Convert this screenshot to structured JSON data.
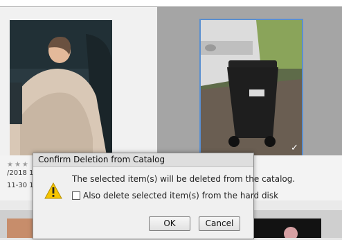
{
  "grid": {
    "left_item": {
      "rating_stars": "★★★",
      "date_text": "/2018 1:4",
      "date_text_2": "11-30 13."
    }
  },
  "dialog": {
    "title": "Confirm Deletion from Catalog",
    "message": "The selected item(s) will be deleted from the catalog.",
    "checkbox_label": "Also delete selected item(s) from the hard disk",
    "ok_label": "OK",
    "cancel_label": "Cancel",
    "warning_icon": "warning-triangle-icon",
    "colors": {
      "warning_fill": "#f6c500",
      "selection_accent": "#5a8fd0"
    }
  },
  "checkmark_glyph": "✓"
}
